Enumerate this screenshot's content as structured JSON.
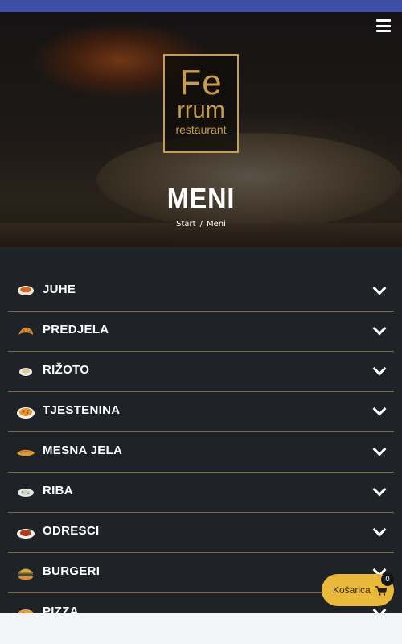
{
  "header": {
    "logo": {
      "line1": "Fe",
      "line2": "rrum",
      "line3": "restaurant"
    },
    "menu_icon": "hamburger-icon"
  },
  "hero": {
    "title": "MENI",
    "breadcrumb": [
      {
        "label": "Start"
      },
      {
        "separator": "/"
      },
      {
        "label": "Meni"
      }
    ]
  },
  "menu_categories": [
    {
      "label": "JUHE",
      "icon": "soup-bowl-icon"
    },
    {
      "label": "PREDJELA",
      "icon": "croissant-icon"
    },
    {
      "label": "RIŽOTO",
      "icon": "rice-bowl-icon"
    },
    {
      "label": "TJESTENINA",
      "icon": "pasta-icon"
    },
    {
      "label": "MESNA JELA",
      "icon": "meat-icon"
    },
    {
      "label": "RIBA",
      "icon": "fish-icon"
    },
    {
      "label": "ODRESCI",
      "icon": "steak-icon"
    },
    {
      "label": "BURGERI",
      "icon": "burger-icon"
    },
    {
      "label": "PIZZA",
      "icon": "pizza-icon"
    }
  ],
  "cart": {
    "label": "Košarica",
    "count": "0",
    "icon": "shopping-cart-icon"
  },
  "colors": {
    "accent_gold": "#c79d4a",
    "cart_yellow": "#e8b93b",
    "top_bar": "#3d4ea5",
    "content_bg": "#1f2328"
  }
}
